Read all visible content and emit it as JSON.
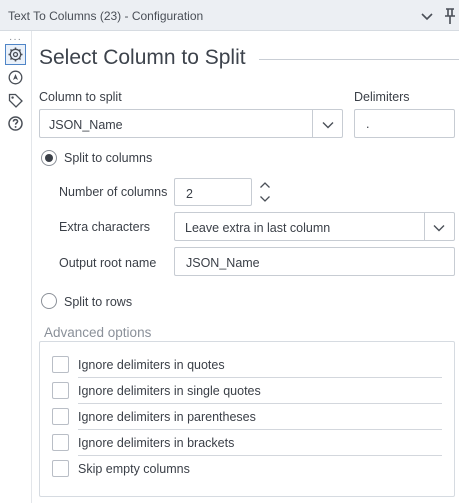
{
  "window": {
    "title": "Text To Columns (23) - Configuration",
    "chevron_icon": "chevron-down-icon",
    "pin_icon": "pin-icon"
  },
  "sidebar": {
    "dots": "···",
    "items": [
      {
        "icon": "gear-icon",
        "active": true
      },
      {
        "icon": "navigate-icon",
        "active": false
      },
      {
        "icon": "tag-icon",
        "active": false
      },
      {
        "icon": "help-icon",
        "active": false
      }
    ]
  },
  "form": {
    "heading": "Select Column to Split",
    "column_to_split": {
      "label": "Column to split",
      "value": "JSON_Name"
    },
    "delimiters": {
      "label": "Delimiters",
      "value": "."
    },
    "split_to_columns": {
      "label": "Split to columns",
      "selected": true
    },
    "number_of_columns": {
      "label": "Number of columns",
      "value": "2"
    },
    "extra_characters": {
      "label": "Extra characters",
      "value": "Leave extra in last column"
    },
    "output_root_name": {
      "label": "Output root name",
      "value": "JSON_Name"
    },
    "split_to_rows": {
      "label": "Split to rows",
      "selected": false
    }
  },
  "advanced": {
    "label": "Advanced options",
    "options": [
      {
        "label": "Ignore delimiters in quotes",
        "checked": false
      },
      {
        "label": "Ignore delimiters in single quotes",
        "checked": false
      },
      {
        "label": "Ignore delimiters in parentheses",
        "checked": false
      },
      {
        "label": "Ignore delimiters in brackets",
        "checked": false
      },
      {
        "label": "Skip empty columns",
        "checked": false
      }
    ]
  },
  "colors": {
    "accent": "#4f85c7",
    "titlebar_bg": "#eceff3",
    "text": "#3a3f47",
    "muted_text": "#8a9099",
    "border": "#c7ccd3"
  }
}
